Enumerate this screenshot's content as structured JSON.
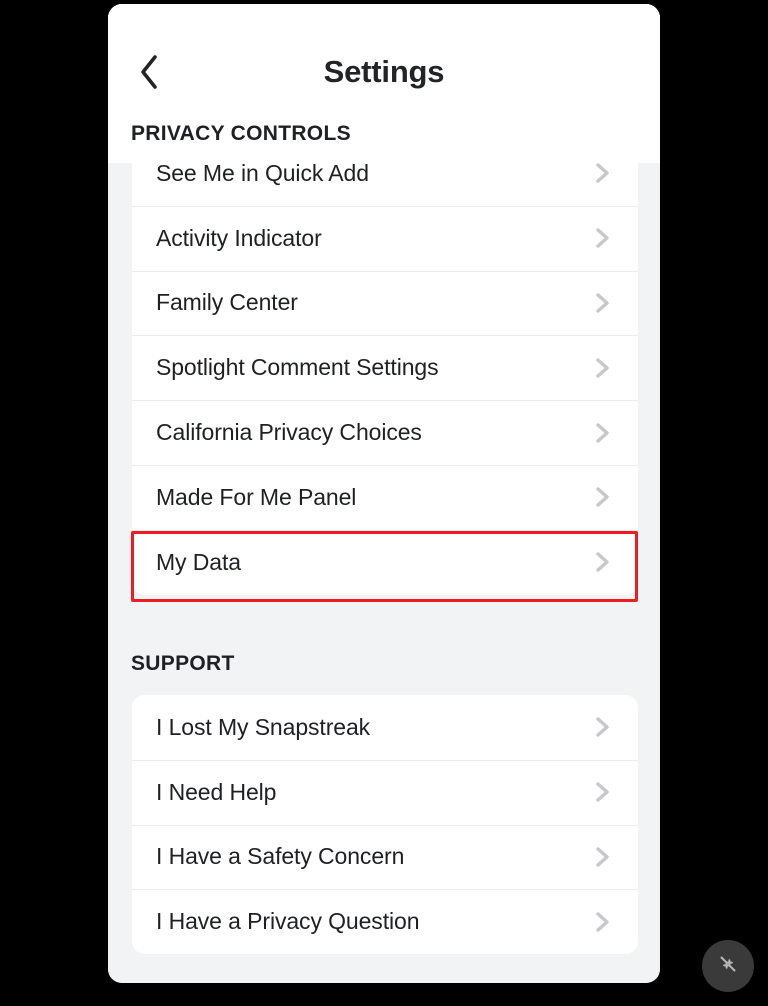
{
  "header": {
    "title": "Settings",
    "back_icon": "chevron-left-icon"
  },
  "privacy_section": {
    "label": "PRIVACY CONTROLS",
    "items": [
      {
        "label": "See Me in Quick Add",
        "chevron": "chevron-right-icon"
      },
      {
        "label": "Activity Indicator",
        "chevron": "chevron-right-icon"
      },
      {
        "label": "Family Center",
        "chevron": "chevron-right-icon"
      },
      {
        "label": "Spotlight Comment Settings",
        "chevron": "chevron-right-icon"
      },
      {
        "label": "California Privacy Choices",
        "chevron": "chevron-right-icon"
      },
      {
        "label": "Made For Me Panel",
        "chevron": "chevron-right-icon"
      },
      {
        "label": "My Data",
        "chevron": "chevron-right-icon"
      }
    ]
  },
  "support_section": {
    "label": "SUPPORT",
    "items": [
      {
        "label": "I Lost My Snapstreak",
        "chevron": "chevron-right-icon"
      },
      {
        "label": "I Need Help",
        "chevron": "chevron-right-icon"
      },
      {
        "label": "I Have a Safety Concern",
        "chevron": "chevron-right-icon"
      },
      {
        "label": "I Have a Privacy Question",
        "chevron": "chevron-right-icon"
      }
    ]
  },
  "annotation": {
    "target_label": "My Data",
    "color": "#ed1c24"
  },
  "floating_button": {
    "icon": "collapse-arrows-icon",
    "background": "#3a3a3a"
  }
}
